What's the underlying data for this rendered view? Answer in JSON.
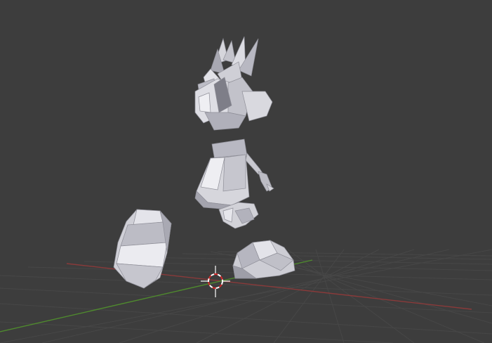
{
  "viewport": {
    "background_color": "#3d3d3d",
    "grid_color": "#4a4a4a",
    "x_axis_color": "#8a3a3a",
    "y_axis_color": "#4f8a2e",
    "mesh_color": "#c9c9ce",
    "cursor_color_a": "#d42a2a",
    "cursor_color_b": "#ffffff"
  },
  "scene": {
    "objects": [
      {
        "name": "hair"
      },
      {
        "name": "head"
      },
      {
        "name": "torso"
      },
      {
        "name": "right-arm"
      },
      {
        "name": "hand"
      },
      {
        "name": "left-foot"
      },
      {
        "name": "right-foot"
      }
    ],
    "cursor_icon": "3d-cursor-icon"
  }
}
